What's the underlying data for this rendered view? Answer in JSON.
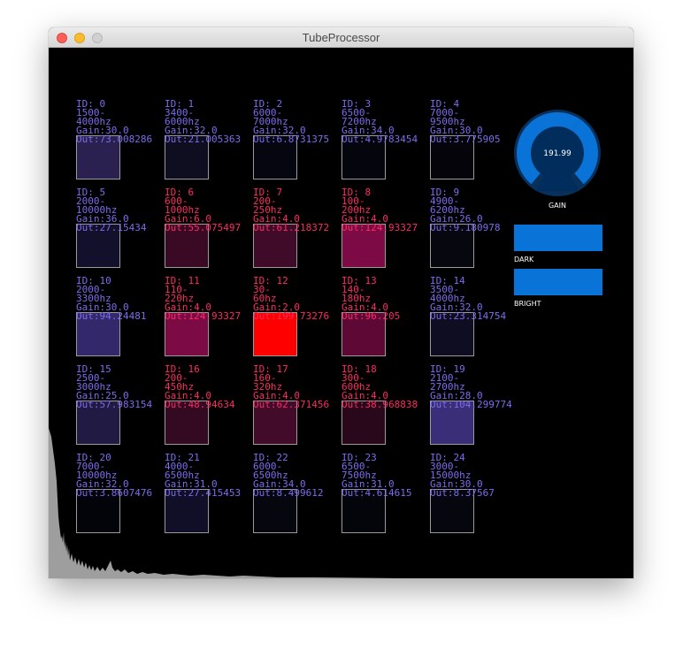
{
  "window": {
    "title": "TubeProcessor"
  },
  "knob": {
    "value": "191.99",
    "label": "GAIN",
    "level": 0.62,
    "colors": {
      "track": "#08305a",
      "fill": "#0a73d8",
      "center": "#002d5c"
    }
  },
  "sliders": [
    {
      "label": "DARK",
      "color": "#0a73d8"
    },
    {
      "label": "BRIGHT",
      "color": "#0a73d8"
    }
  ],
  "grid": {
    "colors": {
      "low_text": "#7a6cf0",
      "high_text": "#ff2a62",
      "active_fill": "#ff0000",
      "border": "#9a9a9a"
    },
    "cells": [
      {
        "id": "ID: 0",
        "range1": "1500-",
        "range2": "4000hz",
        "gain": "Gain:30.0",
        "out": "Out:73.008286",
        "fill": "#2a2150",
        "active": false
      },
      {
        "id": "ID: 1",
        "range1": "3400-",
        "range2": "6000hz",
        "gain": "Gain:32.0",
        "out": "Out:21.005363",
        "fill": "#0f0d20",
        "active": false
      },
      {
        "id": "ID: 2",
        "range1": "6000-",
        "range2": "7000hz",
        "gain": "Gain:32.0",
        "out": "Out:6.8731375",
        "fill": "#060610",
        "active": false
      },
      {
        "id": "ID: 3",
        "range1": "6500-",
        "range2": "7200hz",
        "gain": "Gain:34.0",
        "out": "Out:4.9783454",
        "fill": "#05050d",
        "active": false
      },
      {
        "id": "ID: 4",
        "range1": "7000-",
        "range2": "9500hz",
        "gain": "Gain:30.0",
        "out": "Out:3.775905",
        "fill": "#04040a",
        "active": false
      },
      {
        "id": "ID: 5",
        "range1": "2000-",
        "range2": "10000hz",
        "gain": "Gain:36.0",
        "out": "Out:27.15434",
        "fill": "#12102a",
        "active": false
      },
      {
        "id": "ID: 6",
        "range1": "600-",
        "range2": "1000hz",
        "gain": "Gain:6.0",
        "out": "Out:55.075497",
        "fill": "#3a0a24",
        "active": false
      },
      {
        "id": "ID: 7",
        "range1": "200-",
        "range2": "250hz",
        "gain": "Gain:4.0",
        "out": "Out:61.218372",
        "fill": "#400b28",
        "active": false
      },
      {
        "id": "ID: 8",
        "range1": "100-",
        "range2": "200hz",
        "gain": "Gain:4.0",
        "out": "Out:124.93327",
        "fill": "#7c0a44",
        "active": false
      },
      {
        "id": "ID: 9",
        "range1": "4900-",
        "range2": "6200hz",
        "gain": "Gain:26.0",
        "out": "Out:9.180978",
        "fill": "#07070f",
        "active": false
      },
      {
        "id": "ID: 10",
        "range1": "2000-",
        "range2": "3300hz",
        "gain": "Gain:30.0",
        "out": "Out:94.24481",
        "fill": "#33286a",
        "active": false
      },
      {
        "id": "ID: 11",
        "range1": "110-",
        "range2": "220hz",
        "gain": "Gain:4.0",
        "out": "Out:124.93327",
        "fill": "#7c0a44",
        "active": false
      },
      {
        "id": "ID: 12",
        "range1": "30-",
        "range2": "60hz",
        "gain": "Gain:2.0",
        "out": "Out:199.73276",
        "fill": "#ff0000",
        "active": true
      },
      {
        "id": "ID: 13",
        "range1": "140-",
        "range2": "180hz",
        "gain": "Gain:4.0",
        "out": "Out:96.205",
        "fill": "#5e0836",
        "active": false
      },
      {
        "id": "ID: 14",
        "range1": "3500-",
        "range2": "4000hz",
        "gain": "Gain:32.0",
        "out": "Out:23.314754",
        "fill": "#0f0d22",
        "active": false
      },
      {
        "id": "ID: 15",
        "range1": "2500-",
        "range2": "3000hz",
        "gain": "Gain:25.0",
        "out": "Out:57.983154",
        "fill": "#211a42",
        "active": false
      },
      {
        "id": "ID: 16",
        "range1": "200-",
        "range2": "450hz",
        "gain": "Gain:4.0",
        "out": "Out:48.94634",
        "fill": "#330a22",
        "active": false
      },
      {
        "id": "ID: 17",
        "range1": "160-",
        "range2": "320hz",
        "gain": "Gain:4.0",
        "out": "Out:62.371456",
        "fill": "#420b2a",
        "active": false
      },
      {
        "id": "ID: 18",
        "range1": "300-",
        "range2": "600hz",
        "gain": "Gain:4.0",
        "out": "Out:38.968838",
        "fill": "#2a081c",
        "active": false
      },
      {
        "id": "ID: 19",
        "range1": "2100-",
        "range2": "2700hz",
        "gain": "Gain:28.0",
        "out": "Out:104.299774",
        "fill": "#3a2e78",
        "active": false
      },
      {
        "id": "ID: 20",
        "range1": "7000-",
        "range2": "10000hz",
        "gain": "Gain:32.0",
        "out": "Out:3.8607476",
        "fill": "#03030a",
        "active": false
      },
      {
        "id": "ID: 21",
        "range1": "4000-",
        "range2": "6500hz",
        "gain": "Gain:31.0",
        "out": "Out:27.415453",
        "fill": "#110f28",
        "active": false
      },
      {
        "id": "ID: 22",
        "range1": "6000-",
        "range2": "6500hz",
        "gain": "Gain:34.0",
        "out": "Out:8.499612",
        "fill": "#06060f",
        "active": false
      },
      {
        "id": "ID: 23",
        "range1": "6500-",
        "range2": "7500hz",
        "gain": "Gain:31.0",
        "out": "Out:4.614615",
        "fill": "#04040b",
        "active": false
      },
      {
        "id": "ID: 24",
        "range1": "3000-",
        "range2": "15000hz",
        "gain": "Gain:30.0",
        "out": "Out:8.37567",
        "fill": "#06060e",
        "active": false
      }
    ]
  }
}
